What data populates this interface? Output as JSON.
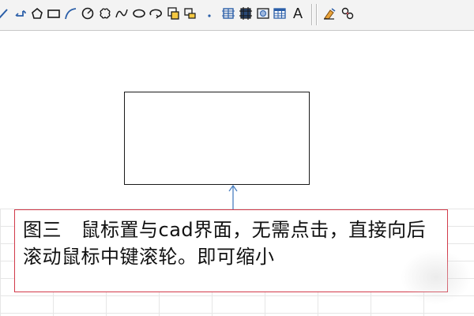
{
  "toolbar": {
    "text_tool_label": "A",
    "icons": [
      "line-icon",
      "polyline-icon",
      "polygon-icon",
      "rectangle-icon",
      "arc-icon",
      "circle-icon",
      "revision-cloud-icon",
      "spline-icon",
      "ellipse-icon",
      "ellipse-arc-icon",
      "insert-block-icon",
      "make-block-icon",
      "point-icon",
      "hatch-icon",
      "gradient-icon",
      "region-icon",
      "table-icon",
      "multiline-text-icon",
      "erase-icon",
      "copy-icon"
    ]
  },
  "colors": {
    "note_border": "#d23a4a",
    "arrow": "#4a7fc0",
    "toolbar_icon_blue": "#2a5ea8"
  },
  "note": {
    "text": "图三　鼠标置与cad界面，无需点击，直接向后滚动鼠标中键滚轮。即可缩小"
  }
}
